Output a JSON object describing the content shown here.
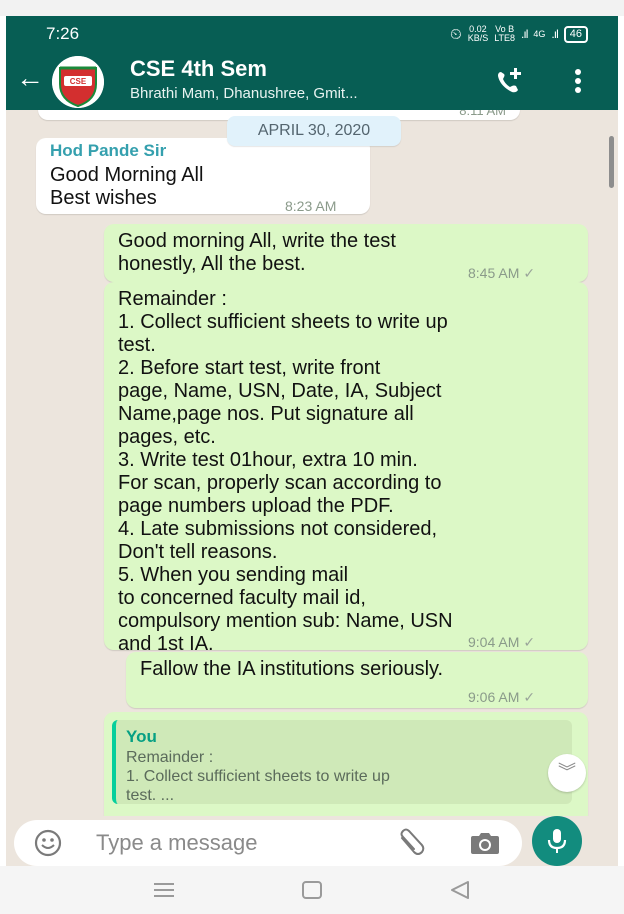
{
  "status_bar": {
    "time": "7:26",
    "speed_value": "0.02",
    "speed_unit": "KB/S",
    "net_top": "Vo B",
    "net_bottom": "LTE8",
    "network_4g": "4G",
    "battery": "46"
  },
  "header": {
    "title": "CSE 4th Sem",
    "subtitle": "Bhrathi Mam, Dhanushree, Gmit...",
    "avatar_text": "CSE"
  },
  "chat": {
    "partial_prev_time": "8:11 AM",
    "date_chip": "APRIL 30, 2020",
    "messages": [
      {
        "sender": "Hod Pande Sir",
        "lines": [
          "Good Morning All",
          "Best wishes"
        ],
        "time": "8:23 AM"
      },
      {
        "lines": [
          "Good morning All, write the test",
          "honestly, All the best."
        ],
        "time": "8:45 AM"
      },
      {
        "lines": [
          "Remainder :",
          "1. Collect sufficient sheets to write up",
          "test.",
          "2. Before start test, write front",
          "page, Name, USN, Date, IA, Subject",
          "Name,page nos. Put signature all",
          "pages, etc.",
          "3. Write test 01hour, extra 10 min.",
          "For scan, properly scan according to",
          "page numbers upload the PDF.",
          "4. Late submissions not considered,",
          "Don't tell reasons.",
          "5. When you sending mail",
          "to concerned faculty mail id,",
          "compulsory mention sub: Name, USN",
          "and 1st IA."
        ],
        "time": "9:04 AM"
      },
      {
        "lines": [
          "Fallow the IA institutions   seriously."
        ],
        "time": "9:06 AM"
      }
    ],
    "reply_quote": {
      "name": "You",
      "line1": "Remainder :",
      "line2": "1. Collect sufficient sheets to write up",
      "line3": "test. ..."
    },
    "tick": "✓"
  },
  "input_bar": {
    "placeholder": "Type a message"
  },
  "colors": {
    "header": "#075e54",
    "outgoing_bubble": "#dcf8c6",
    "incoming_bubble": "#ffffff",
    "chat_background": "#ece5dd",
    "mic_button": "#128c7e"
  },
  "icons": [
    "back-arrow-icon",
    "add-call-icon",
    "more-options-icon",
    "emoji-icon",
    "attach-icon",
    "camera-icon",
    "mic-icon",
    "scroll-down-icon",
    "alarm-icon"
  ]
}
